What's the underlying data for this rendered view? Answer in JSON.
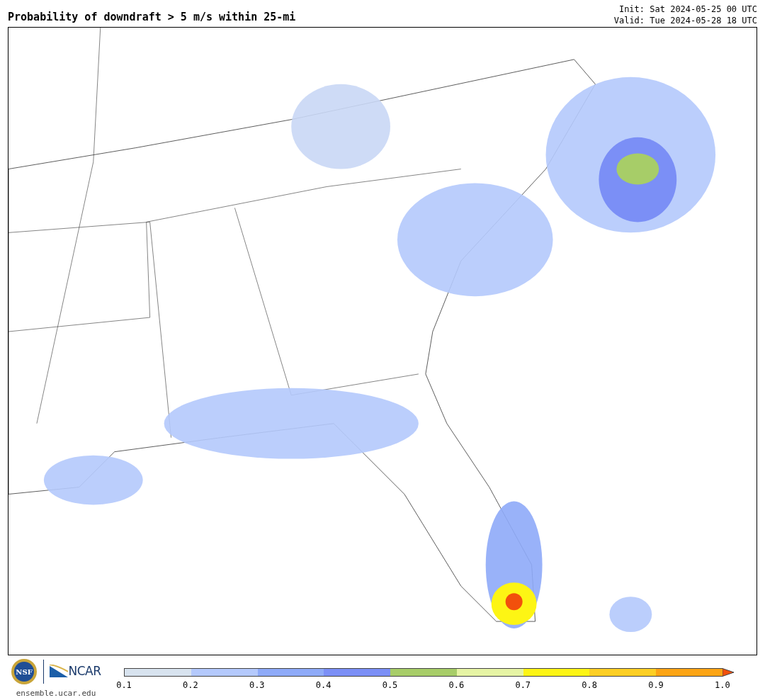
{
  "title": "Probability of downdraft > 5 m/s within 25-mi",
  "init": "Init: Sat 2024-05-25 00 UTC",
  "valid": "Valid: Tue 2024-05-28 18 UTC",
  "logos": {
    "nsf": "NSF",
    "ncar": "NCAR",
    "site": "ensemble.ucar.edu"
  },
  "colorbar": {
    "bins": [
      {
        "color": "#d8e3ef"
      },
      {
        "color": "#b4c9fc"
      },
      {
        "color": "#8eaaf8"
      },
      {
        "color": "#7b8ff6"
      },
      {
        "color": "#a7cd68"
      },
      {
        "color": "#e6f4a4"
      },
      {
        "color": "#fdf514"
      },
      {
        "color": "#fdcf24"
      },
      {
        "color": "#fca414"
      }
    ],
    "extend": {
      "color": "#f2500c"
    },
    "ticks": [
      "0.1",
      "0.2",
      "0.3",
      "0.4",
      "0.5",
      "0.6",
      "0.7",
      "0.8",
      "0.9",
      "1.0"
    ]
  }
}
